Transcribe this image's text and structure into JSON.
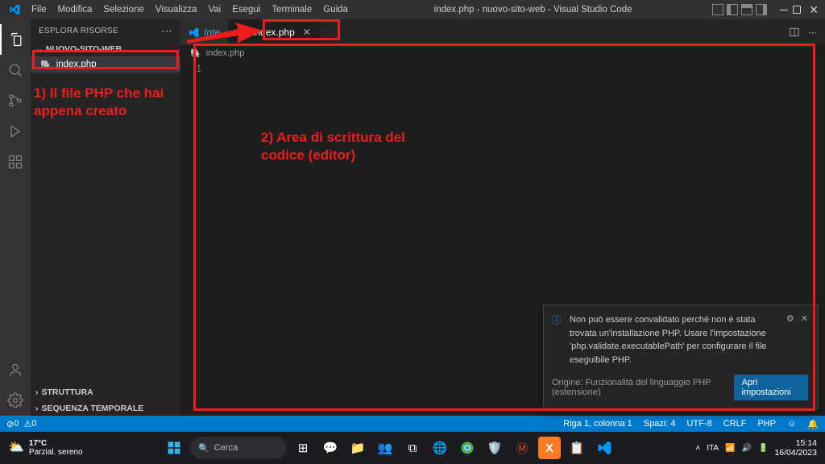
{
  "titlebar": {
    "menus": [
      "File",
      "Modifica",
      "Selezione",
      "Visualizza",
      "Vai",
      "Esegui",
      "Terminale",
      "Guida"
    ],
    "title": "index.php - nuovo-sito-web - Visual Studio Code"
  },
  "sidebar": {
    "header": "ESPLORA RISORSE",
    "folder": "NUOVO-SITO-WEB",
    "file": "index.php",
    "outline": "STRUTTURA",
    "timeline": "SEQUENZA TEMPORALE"
  },
  "tabs": {
    "inactive": "Inte",
    "active": "index.php"
  },
  "breadcrumb": "index.php",
  "editor": {
    "first_line_no": "1"
  },
  "notification": {
    "message": "Non può essere convalidato perché non è stata trovata un'installazione PHP. Usare l'impostazione 'php.validate.executablePath' per configurare il file eseguibile PHP.",
    "source": "Origine: Funzionalità del linguaggio PHP (estensione)",
    "button": "Apri impostazioni"
  },
  "statusbar": {
    "errors": "0",
    "warnings": "0",
    "position": "Riga 1, colonna 1",
    "spaces": "Spazi: 4",
    "encoding": "UTF-8",
    "eol": "CRLF",
    "lang": "PHP"
  },
  "annotations": {
    "a1": "1) Il file PHP che hai appena creato",
    "a2": "2) Area di scrittura del codice (editor)"
  },
  "taskbar": {
    "temp": "17°C",
    "weather": "Parzial. sereno",
    "search": "Cerca",
    "time": "15:14",
    "date": "16/04/2023"
  }
}
